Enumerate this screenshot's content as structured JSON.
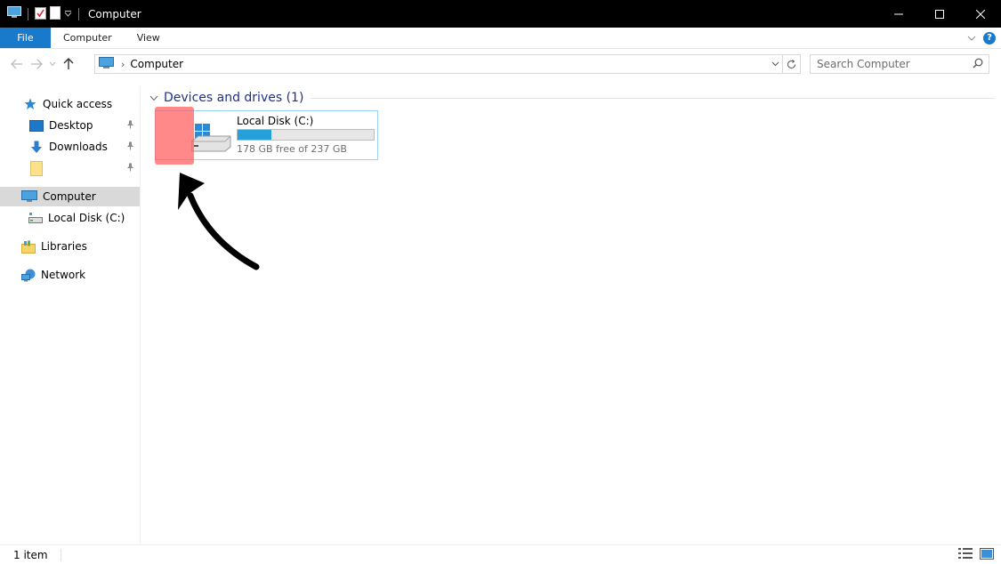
{
  "window": {
    "title": "Computer",
    "controls": [
      "minimize",
      "maximize",
      "close"
    ]
  },
  "ribbon": {
    "tabs": [
      {
        "label": "File",
        "active": true
      },
      {
        "label": "Computer"
      },
      {
        "label": "View"
      }
    ]
  },
  "address": {
    "breadcrumb": [
      "Computer"
    ],
    "search_placeholder": "Search Computer"
  },
  "sidebar": {
    "items": [
      {
        "label": "Quick access",
        "icon": "star-icon"
      },
      {
        "label": "Desktop",
        "icon": "desktop-icon",
        "pinned": true
      },
      {
        "label": "Downloads",
        "icon": "download-arrow-icon",
        "pinned": true
      },
      {
        "label": "",
        "icon": "folder-icon",
        "pinned": true
      },
      {
        "label": "Computer",
        "icon": "computer-icon",
        "selected": true
      },
      {
        "label": "Local Disk (C:)",
        "icon": "drive-icon"
      },
      {
        "label": "Libraries",
        "icon": "libraries-icon"
      },
      {
        "label": "Network",
        "icon": "network-icon"
      }
    ]
  },
  "main": {
    "group_title": "Devices and drives (1)",
    "drives": [
      {
        "name": "Local Disk (C:)",
        "free_text": "178 GB free of 237 GB",
        "used_fraction": 0.249
      }
    ]
  },
  "status": {
    "item_count": "1 item"
  },
  "colors": {
    "accent": "#1979ca",
    "drive_bar": "#26a0da",
    "highlight": "#ff7a7a"
  }
}
